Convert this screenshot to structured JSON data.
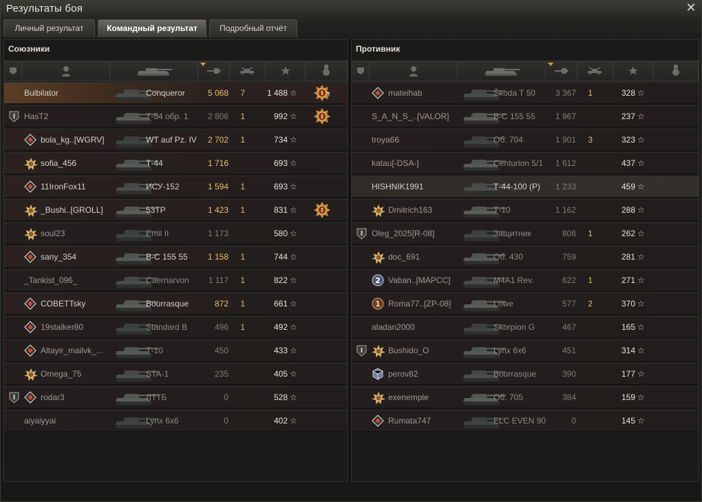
{
  "window": {
    "title": "Результаты боя",
    "close_icon": "close-icon"
  },
  "tabs": [
    {
      "label": "Личный результат",
      "active": false
    },
    {
      "label": "Командный результат",
      "active": true
    },
    {
      "label": "Подробный отчёт",
      "active": false
    }
  ],
  "allies": {
    "title": "Союзники",
    "rows": [
      {
        "platoon": false,
        "rank": "",
        "name": "Bulbilator",
        "vehicle": "Conqueror",
        "damage": "5 068",
        "kills": "7",
        "xp": "1 488",
        "medal": "medal-icon",
        "medal_count": "3",
        "state": "self"
      },
      {
        "platoon": true,
        "rank": "",
        "name": "HasT2",
        "vehicle": "Т-54 обр. 1",
        "damage": "2 806",
        "kills": "1",
        "xp": "992",
        "medal": "medal-icon",
        "medal_count": "",
        "state": "dead"
      },
      {
        "platoon": false,
        "rank": "rank-icon",
        "name": "bola_kg..[WGRV]",
        "vehicle": "WT auf Pz. IV",
        "damage": "2 702",
        "kills": "1",
        "xp": "734",
        "medal": "",
        "medal_count": "",
        "state": ""
      },
      {
        "platoon": false,
        "rank": "star-rank-icon",
        "name": "sofia_456",
        "vehicle": "Т-44",
        "damage": "1 716",
        "kills": "",
        "xp": "693",
        "medal": "",
        "medal_count": "",
        "state": ""
      },
      {
        "platoon": false,
        "rank": "rank-icon",
        "name": "11IronFox11",
        "vehicle": "ИСУ-152",
        "damage": "1 594",
        "kills": "1",
        "xp": "693",
        "medal": "",
        "medal_count": "",
        "state": ""
      },
      {
        "platoon": false,
        "rank": "star-rank-icon",
        "name": "_Bushi..[GROLL]",
        "vehicle": "53TP",
        "damage": "1 423",
        "kills": "1",
        "xp": "831",
        "medal": "medal-icon",
        "medal_count": "",
        "state": ""
      },
      {
        "platoon": false,
        "rank": "star-rank-icon",
        "name": "soul23",
        "vehicle": "Emil II",
        "damage": "1 173",
        "kills": "",
        "xp": "580",
        "medal": "",
        "medal_count": "",
        "state": "dead"
      },
      {
        "platoon": false,
        "rank": "rank-icon",
        "name": "sany_354",
        "vehicle": "В-С 155 55",
        "damage": "1 158",
        "kills": "1",
        "xp": "744",
        "medal": "",
        "medal_count": "",
        "state": ""
      },
      {
        "platoon": false,
        "rank": "",
        "name": "_Tankist_096_",
        "vehicle": "Caernarvon",
        "damage": "1 117",
        "kills": "1",
        "xp": "822",
        "medal": "",
        "medal_count": "",
        "state": "dead"
      },
      {
        "platoon": false,
        "rank": "rank-icon",
        "name": "COBETTsky",
        "vehicle": "Bourrasque",
        "damage": "872",
        "kills": "1",
        "xp": "661",
        "medal": "",
        "medal_count": "",
        "state": ""
      },
      {
        "platoon": false,
        "rank": "rank-icon",
        "name": "19stalker80",
        "vehicle": "Standard B",
        "damage": "496",
        "kills": "1",
        "xp": "492",
        "medal": "",
        "medal_count": "",
        "state": "dead"
      },
      {
        "platoon": false,
        "rank": "rank-icon",
        "name": "Altayir_mailvk_...",
        "vehicle": "Т-10",
        "damage": "450",
        "kills": "",
        "xp": "433",
        "medal": "",
        "medal_count": "",
        "state": "dead"
      },
      {
        "platoon": false,
        "rank": "star-rank-icon",
        "name": "Omega_75",
        "vehicle": "STA-1",
        "damage": "235",
        "kills": "",
        "xp": "405",
        "medal": "",
        "medal_count": "",
        "state": "dead"
      },
      {
        "platoon": true,
        "rank": "rank-icon",
        "name": "rodar3",
        "vehicle": "ЛТТБ",
        "damage": "0",
        "kills": "",
        "xp": "528",
        "medal": "",
        "medal_count": "",
        "state": "dead"
      },
      {
        "platoon": false,
        "rank": "",
        "name": "aiyaiyyai",
        "vehicle": "Lynx 6x6",
        "damage": "0",
        "kills": "",
        "xp": "402",
        "medal": "",
        "medal_count": "",
        "state": "dead"
      }
    ]
  },
  "enemies": {
    "title": "Противник",
    "rows": [
      {
        "platoon": false,
        "rank": "rank-icon",
        "name": "mateihab",
        "vehicle": "Škoda T 50",
        "damage": "3 367",
        "kills": "1",
        "xp": "328",
        "state": "dead"
      },
      {
        "platoon": false,
        "rank": "",
        "name": "S_A_N_S_..[VALOR]",
        "vehicle": "В-С 155 55",
        "damage": "1 967",
        "kills": "",
        "xp": "237",
        "state": "dead"
      },
      {
        "platoon": false,
        "rank": "",
        "name": "troya66",
        "vehicle": "Об. 704",
        "damage": "1 901",
        "kills": "3",
        "xp": "323",
        "state": "dead"
      },
      {
        "platoon": false,
        "rank": "",
        "name": "katau[-DSA-]",
        "vehicle": "Centurion 5/1",
        "damage": "1 612",
        "kills": "",
        "xp": "437",
        "state": "dead"
      },
      {
        "platoon": false,
        "rank": "",
        "name": "HISHNIK1991",
        "vehicle": "Т-44-100 (Р)",
        "damage": "1 233",
        "kills": "",
        "xp": "459",
        "state": "hl"
      },
      {
        "platoon": false,
        "rank": "star-rank-icon",
        "name": "Dmitrich163",
        "vehicle": "Т-10",
        "damage": "1 162",
        "kills": "",
        "xp": "288",
        "state": "dead"
      },
      {
        "platoon": true,
        "rank": "",
        "name": "Oleg_2025[R-08]",
        "vehicle": "Защитник",
        "damage": "806",
        "kills": "1",
        "xp": "262",
        "state": "dead"
      },
      {
        "platoon": false,
        "rank": "star-rank-icon",
        "name": "doc_691",
        "vehicle": "Об. 430",
        "damage": "759",
        "kills": "",
        "xp": "281",
        "state": "dead"
      },
      {
        "platoon": false,
        "rank": "badge-2-icon",
        "name": "Vaban..[MAPCC]",
        "vehicle": "M4A1 Rev.",
        "damage": "622",
        "kills": "1",
        "xp": "271",
        "state": "dead"
      },
      {
        "platoon": false,
        "rank": "badge-1-icon",
        "name": "Roma77..[ZP-08]",
        "vehicle": "Löwe",
        "damage": "577",
        "kills": "2",
        "xp": "370",
        "state": "dead"
      },
      {
        "platoon": false,
        "rank": "",
        "name": "aladan2000",
        "vehicle": "Skorpion G",
        "damage": "467",
        "kills": "",
        "xp": "165",
        "state": "dead"
      },
      {
        "platoon": true,
        "rank": "star-rank-icon",
        "name": "Bushido_O",
        "vehicle": "Lynx 6x6",
        "damage": "451",
        "kills": "",
        "xp": "314",
        "state": "dead"
      },
      {
        "platoon": false,
        "rank": "cube-rank-icon",
        "name": "perov82",
        "vehicle": "Bourrasque",
        "damage": "390",
        "kills": "",
        "xp": "177",
        "state": "dead"
      },
      {
        "platoon": false,
        "rank": "star-rank-icon",
        "name": "exenemple",
        "vehicle": "Об. 705",
        "damage": "384",
        "kills": "",
        "xp": "159",
        "state": "dead"
      },
      {
        "platoon": false,
        "rank": "rank-icon",
        "name": "Rumata747",
        "vehicle": "ELC EVEN 90",
        "damage": "0",
        "kills": "",
        "xp": "145",
        "state": "dead"
      }
    ]
  },
  "xp_star": "☆",
  "columns": [
    "platoon-icon",
    "player-icon",
    "vehicle-icon",
    "damage-icon",
    "kills-icon",
    "xp-icon",
    "medal-icon"
  ]
}
